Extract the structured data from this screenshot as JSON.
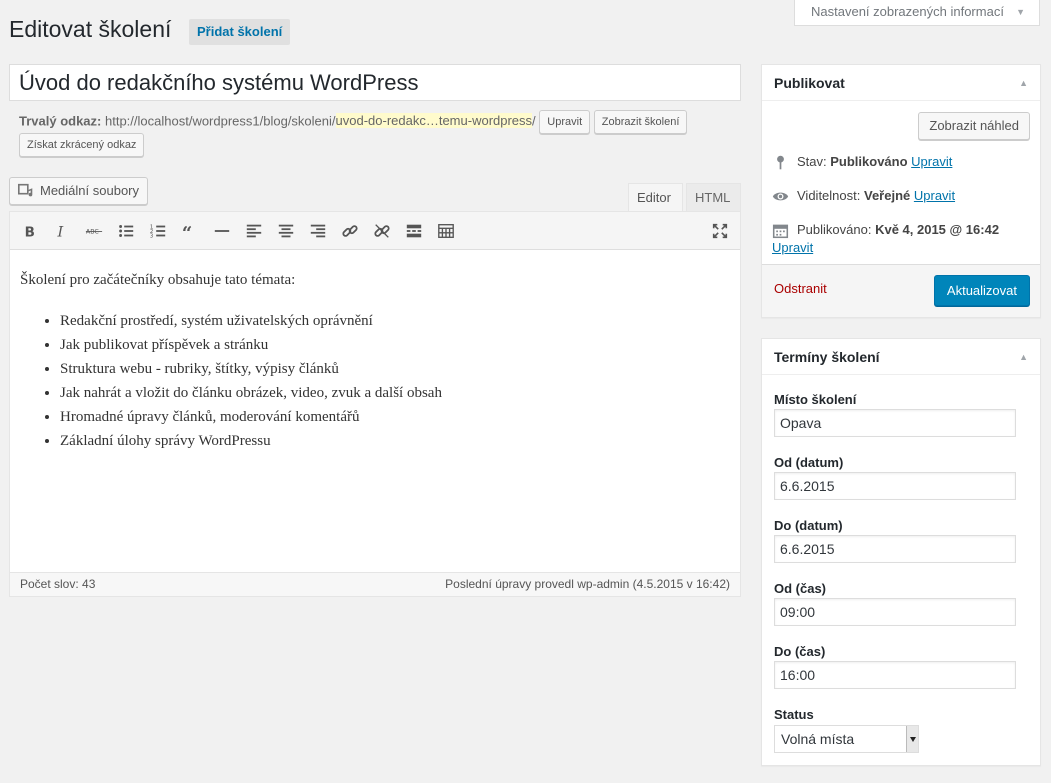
{
  "screen_options": {
    "label": "Nastavení zobrazených informací"
  },
  "header": {
    "title": "Editovat školení",
    "add_new": "Přidat školení"
  },
  "post": {
    "title": "Úvod do redakčního systému WordPress",
    "permalink_label": "Trvalý odkaz:",
    "permalink_base": "http://localhost/wordpress1/blog/skoleni/",
    "permalink_slug": "uvod-do-redakc…temu-wordpress",
    "permalink_end": "/",
    "edit_button": "Upravit",
    "view_button": "Zobrazit školení",
    "shortlink_button": "Získat zkrácený odkaz"
  },
  "editor": {
    "media_button": "Mediální soubory",
    "tabs": {
      "visual": "Editor",
      "html": "HTML"
    },
    "content_intro": "Školení pro začátečníky obsahuje tato témata:",
    "content_list": [
      "Redakční prostředí, systém uživatelských oprávnění",
      "Jak publikovat příspěvek a stránku",
      "Struktura webu - rubriky, štítky, výpisy článků",
      "Jak nahrát a vložit do článku obrázek, video, zvuk a další obsah",
      "Hromadné úpravy článků, moderování komentářů",
      "Základní úlohy správy WordPressu"
    ],
    "word_count": "Počet slov: 43",
    "last_edit": "Poslední úpravy provedl wp-admin (4.5.2015 v 16:42)"
  },
  "publish_box": {
    "title": "Publikovat",
    "preview_button": "Zobrazit náhled",
    "status_label": "Stav:",
    "status_value": "Publikováno",
    "visibility_label": "Viditelnost:",
    "visibility_value": "Veřejné",
    "published_label": "Publikováno:",
    "published_value": "Kvě 4, 2015 @ 16:42",
    "edit_link": "Upravit",
    "delete_link": "Odstranit",
    "update_button": "Aktualizovat"
  },
  "terms_box": {
    "title": "Termíny školení",
    "fields": [
      {
        "label": "Místo školení",
        "value": "Opava"
      },
      {
        "label": "Od (datum)",
        "value": "6.6.2015"
      },
      {
        "label": "Do (datum)",
        "value": "6.6.2015"
      },
      {
        "label": "Od (čas)",
        "value": "09:00"
      },
      {
        "label": "Do (čas)",
        "value": "16:00"
      }
    ],
    "status_label": "Status",
    "status_value": "Volná místa"
  },
  "colors": {
    "primary": "#0085ba",
    "link": "#0073aa",
    "delete": "#aa0000",
    "slug_highlight": "#fffbcc"
  }
}
